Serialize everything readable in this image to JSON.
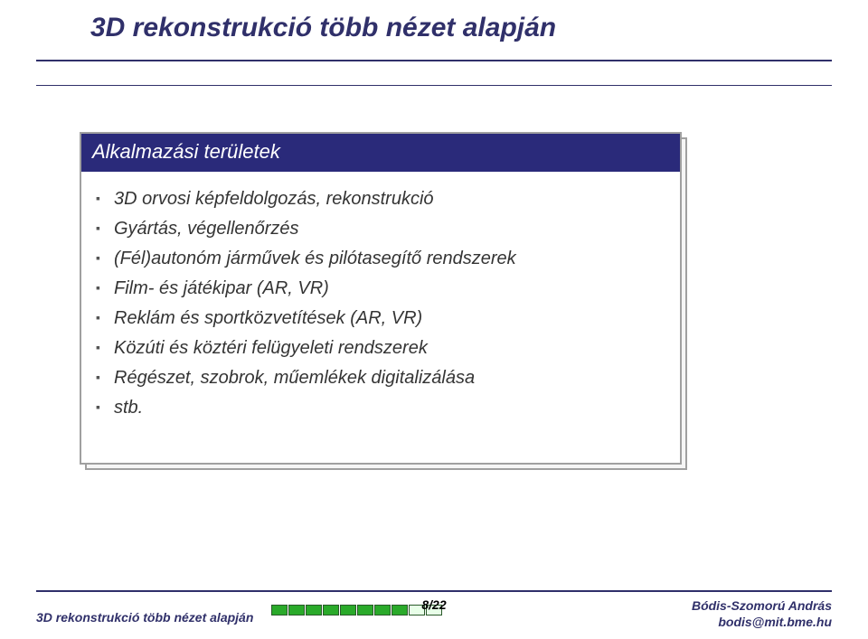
{
  "title": "3D rekonstrukció több nézet alapján",
  "box": {
    "header": "Alkalmazási területek",
    "items": [
      "3D orvosi képfeldolgozás, rekonstrukció",
      "Gyártás, végellenőrzés",
      "(Fél)autonóm járművek és pilótasegítő rendszerek",
      "Film- és játékipar (AR, VR)",
      "Reklám és sportközvetítések (AR, VR)",
      "Közúti és köztéri felügyeleti rendszerek",
      "Régészet, szobrok, műemlékek digitalizálása",
      "stb."
    ]
  },
  "footer": {
    "left": "3D rekonstrukció több nézet alapján",
    "page": "8/22",
    "author": "Bódis-Szomorú András",
    "email": "bodis@mit.bme.hu"
  },
  "progress": {
    "filled": 8,
    "total": 10
  }
}
